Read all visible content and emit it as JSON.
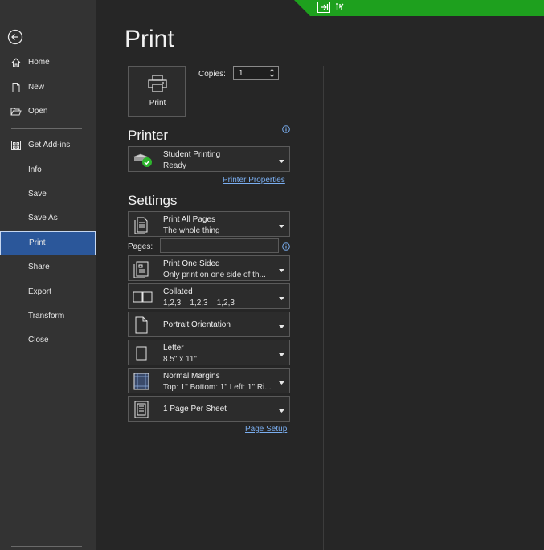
{
  "nav": {
    "items": [
      {
        "label": "Home",
        "icon": "home-icon"
      },
      {
        "label": "New",
        "icon": "new-document-icon"
      },
      {
        "label": "Open",
        "icon": "folder-open-icon"
      },
      {
        "label": "Get Add-ins",
        "icon": "add-ins-grid-icon"
      },
      {
        "label": "Info"
      },
      {
        "label": "Save"
      },
      {
        "label": "Save As"
      },
      {
        "label": "Print"
      },
      {
        "label": "Share"
      },
      {
        "label": "Export"
      },
      {
        "label": "Transform"
      },
      {
        "label": "Close"
      }
    ],
    "selected": "Print",
    "selected_color": "#2b579a"
  },
  "page": {
    "title": "Print"
  },
  "print_button": {
    "label": "Print"
  },
  "copies": {
    "label": "Copies:",
    "value": "1"
  },
  "printer": {
    "heading": "Printer",
    "name": "Student Printing",
    "status": "Ready",
    "properties_link": "Printer Properties"
  },
  "settings": {
    "heading": "Settings",
    "range": {
      "line1": "Print All Pages",
      "line2": "The whole thing"
    },
    "pages_label": "Pages:",
    "pages_value": "",
    "sides": {
      "line1": "Print One Sided",
      "line2": "Only print on one side of th..."
    },
    "collation": {
      "line1": "Collated",
      "line2": "1,2,3    1,2,3    1,2,3"
    },
    "orientation": {
      "line1": "Portrait Orientation"
    },
    "paper": {
      "line1": "Letter",
      "line2": "8.5\" x 11\""
    },
    "margins": {
      "line1": "Normal Margins",
      "line2": "Top: 1\" Bottom: 1\" Left: 1\" Ri..."
    },
    "per_sheet": {
      "line1": "1 Page Per Sheet"
    },
    "page_setup_link": "Page Setup"
  },
  "colors": {
    "status_bar": "#1ea01e",
    "link": "#7aaef0",
    "ready_check": "#2db52d"
  }
}
